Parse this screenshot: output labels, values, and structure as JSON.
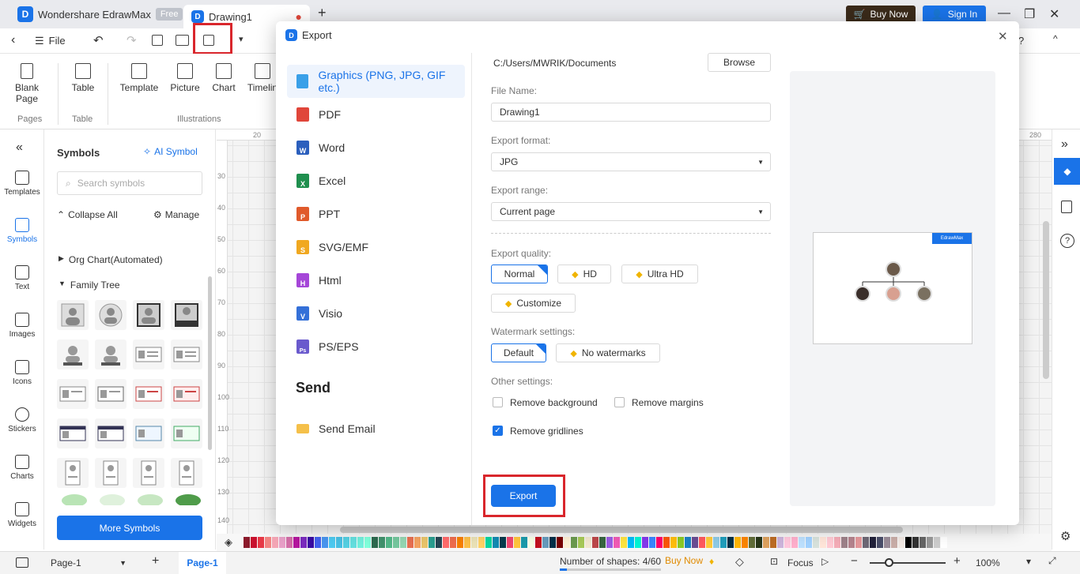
{
  "app": {
    "name": "Wondershare EdrawMax",
    "plan_badge": "Free",
    "doc_tab": "Drawing1",
    "buy_now": "Buy Now",
    "sign_in": "Sign In"
  },
  "toolbar": {
    "file": "File"
  },
  "ribbon": {
    "items": [
      {
        "label": "Blank\nPage",
        "icon": "blank-page-icon"
      },
      {
        "label": "Table",
        "icon": "table-icon"
      },
      {
        "label": "Template",
        "icon": "template-icon"
      },
      {
        "label": "Picture",
        "icon": "picture-icon"
      },
      {
        "label": "Chart",
        "icon": "chart-icon"
      },
      {
        "label": "Timelin",
        "icon": "timeline-icon"
      }
    ],
    "groups": [
      "Pages",
      "Table",
      "Illustrations"
    ]
  },
  "leftbar": {
    "items": [
      "Templates",
      "Symbols",
      "Text",
      "Images",
      "Icons",
      "Stickers",
      "Charts",
      "Widgets"
    ]
  },
  "symbols": {
    "title": "Symbols",
    "ai_symbol": "AI Symbol",
    "search_placeholder": "Search symbols",
    "collapse_all": "Collapse All",
    "manage": "Manage",
    "cat_org": "Org Chart(Automated)",
    "cat_family": "Family Tree",
    "more": "More Symbols"
  },
  "ruler": {
    "top": [
      "20",
      "280"
    ],
    "left": [
      "30",
      "40",
      "50",
      "60",
      "70",
      "80",
      "90",
      "100",
      "110",
      "120",
      "130",
      "140"
    ]
  },
  "dialog": {
    "title": "Export",
    "formats": [
      "Graphics (PNG, JPG, GIF etc.)",
      "PDF",
      "Word",
      "Excel",
      "PPT",
      "SVG/EMF",
      "Html",
      "Visio",
      "PS/EPS"
    ],
    "format_icons": [
      {
        "letter": "",
        "color": "#3aa0e8"
      },
      {
        "letter": "",
        "color": "#e0463a"
      },
      {
        "letter": "W",
        "color": "#2b5fbd"
      },
      {
        "letter": "X",
        "color": "#1f8f4e"
      },
      {
        "letter": "P",
        "color": "#e05a2b"
      },
      {
        "letter": "S",
        "color": "#f0a820"
      },
      {
        "letter": "H",
        "color": "#a546d8"
      },
      {
        "letter": "V",
        "color": "#3470d8"
      },
      {
        "letter": "Ps",
        "color": "#6a5acd"
      }
    ],
    "send_heading": "Send",
    "send_email": "Send Email",
    "path": "C:/Users/MWRIK/Documents",
    "browse": "Browse",
    "file_name_label": "File Name:",
    "file_name": "Drawing1",
    "format_label": "Export format:",
    "format_value": "JPG",
    "range_label": "Export range:",
    "range_value": "Current page",
    "quality_label": "Export quality:",
    "quality": [
      "Normal",
      "HD",
      "Ultra HD",
      "Customize"
    ],
    "watermark_label": "Watermark settings:",
    "watermark": [
      "Default",
      "No watermarks"
    ],
    "other_label": "Other settings:",
    "remove_background": "Remove background",
    "remove_margins": "Remove margins",
    "remove_gridlines": "Remove gridlines",
    "export_button": "Export",
    "preview_badge": "EdrawMax"
  },
  "status": {
    "page_select": "Page-1",
    "page_tab": "Page-1",
    "shapes": "Number of shapes: 4/60",
    "buy_now": "Buy Now",
    "focus": "Focus",
    "zoom": "100%"
  },
  "palette": [
    "#8b1a2b",
    "#c8102e",
    "#e63946",
    "#f28482",
    "#f4a6b5",
    "#e8a0c8",
    "#d46fa8",
    "#b5179e",
    "#7b2cbf",
    "#3a0ca3",
    "#4361ee",
    "#4895ef",
    "#4cc9f0",
    "#48bfe3",
    "#56cfe1",
    "#64dfdf",
    "#72efdd",
    "#80ffdb",
    "#2d6a4f",
    "#40916c",
    "#52b788",
    "#74c69d",
    "#95d5b2",
    "#e76f51",
    "#f4a261",
    "#e9c46a",
    "#2a9d8f",
    "#264653",
    "#ff6b6b",
    "#ee6c4d",
    "#f77f00",
    "#fcbf49",
    "#eae2b7",
    "#ffd166",
    "#06d6a0",
    "#118ab2",
    "#073b4c",
    "#ef476f",
    "#ffc43d",
    "#1b9aaa",
    "#f8ffe5",
    "#c1121f",
    "#669bbc",
    "#003049",
    "#780000",
    "#fdf0d5",
    "#6a994e",
    "#a7c957",
    "#f2e8cf",
    "#bc4749",
    "#386641",
    "#9b5de5",
    "#f15bb5",
    "#fee440",
    "#00bbf9",
    "#00f5d4",
    "#8338ec",
    "#3a86ff",
    "#ff006e",
    "#fb5607",
    "#ffbe0b",
    "#8ac926",
    "#1982c4",
    "#6a4c93",
    "#ff595e",
    "#ffca3a",
    "#8ecae6",
    "#219ebc",
    "#023047",
    "#ffb703",
    "#fb8500",
    "#606c38",
    "#283618",
    "#dda15e",
    "#bc6c25",
    "#cdb4db",
    "#ffc8dd",
    "#ffafcc",
    "#bde0fe",
    "#a2d2ff",
    "#d8e2dc",
    "#ffe5d9",
    "#ffcad4",
    "#f4acb7",
    "#9d8189",
    "#b5838d",
    "#e5989b",
    "#6d6875",
    "#22223b",
    "#4a4e69",
    "#9a8c98",
    "#c9ada7",
    "#f2e9e4",
    "#000000",
    "#333333",
    "#666666",
    "#999999",
    "#cccccc",
    "#ffffff"
  ]
}
